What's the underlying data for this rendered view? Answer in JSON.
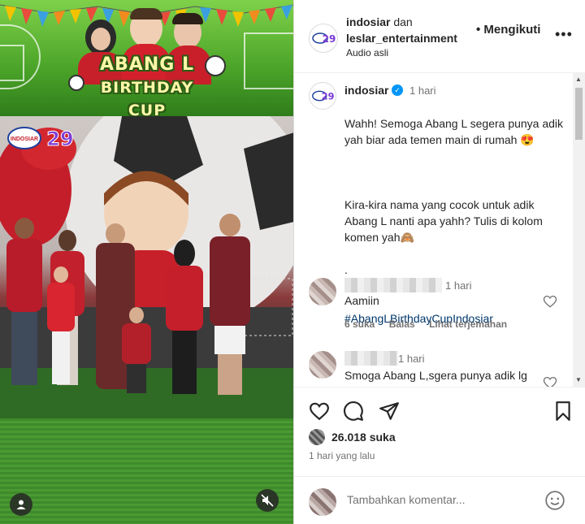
{
  "media": {
    "banner_title_line1": "ABANG L",
    "banner_title_line2": "BIRTHDAY CUP",
    "channel_logo_text": "INDOSIAR",
    "channel_logo_number": "29"
  },
  "header": {
    "account_1": "indosiar",
    "and_word": "dan",
    "account_2": "leslar_entertainment",
    "audio": "Audio asli",
    "follow_label": "• Mengikuti",
    "more_label": "•••"
  },
  "caption": {
    "username": "indosiar",
    "verified_mark": "✓",
    "time": "1 hari",
    "text_1": "Wahh! Semoga Abang L segera punya adik yah biar ada temen main di rumah 😍",
    "text_2": "Kira-kira nama yang cocok untuk adik Abang L nanti apa yahh? Tulis di kolom komen yah🙈",
    "dots": ".\n.",
    "hashtag": "#AbangLBirthdayCupIndosiar"
  },
  "comments": [
    {
      "time": "1 hari",
      "text": "Aamiin",
      "likes": "6 suka",
      "reply": "Balas",
      "translate": "Lihat terjemahan"
    },
    {
      "time": "1 hari",
      "text": "Smoga Abang L,sgera punya adik lg"
    }
  ],
  "actions": {
    "likes_count": "26.018 suka",
    "date": "1 hari yang lalu"
  },
  "add_comment": {
    "placeholder": "Tambahkan komentar..."
  },
  "colors": {
    "verified": "#0095f6",
    "hashtag": "#00376b",
    "muted": "#737373"
  },
  "icons": [
    "heart-icon",
    "comment-icon",
    "share-icon",
    "bookmark-icon",
    "emoji-icon",
    "mute-icon",
    "user-tag-icon"
  ]
}
